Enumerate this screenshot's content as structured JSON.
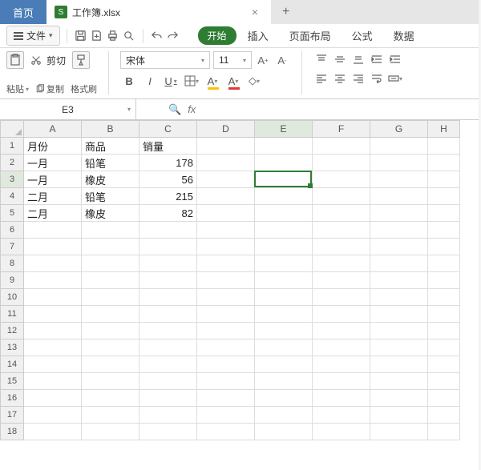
{
  "tabs": {
    "home": "首页",
    "file": "工作簿.xlsx"
  },
  "file_menu": "文件",
  "ribbon_tabs": {
    "start": "开始",
    "insert": "插入",
    "layout": "页面布局",
    "formula": "公式",
    "data": "数据"
  },
  "clipboard": {
    "paste": "粘贴",
    "cut": "剪切",
    "copy": "复制",
    "painter": "格式刷"
  },
  "font": {
    "name": "宋体",
    "size": "11"
  },
  "name_box": "E3",
  "fx_label": "fx",
  "columns": [
    "A",
    "B",
    "C",
    "D",
    "E",
    "F",
    "G",
    "H"
  ],
  "selected_col": "E",
  "selected_row": 3,
  "row_count": 18,
  "data_rows": [
    {
      "A": "月份",
      "B": "商品",
      "C": "销量"
    },
    {
      "A": "一月",
      "B": "铅笔",
      "C": "178"
    },
    {
      "A": "一月",
      "B": "橡皮",
      "C": "56"
    },
    {
      "A": "二月",
      "B": "铅笔",
      "C": "215"
    },
    {
      "A": "二月",
      "B": "橡皮",
      "C": "82"
    }
  ]
}
